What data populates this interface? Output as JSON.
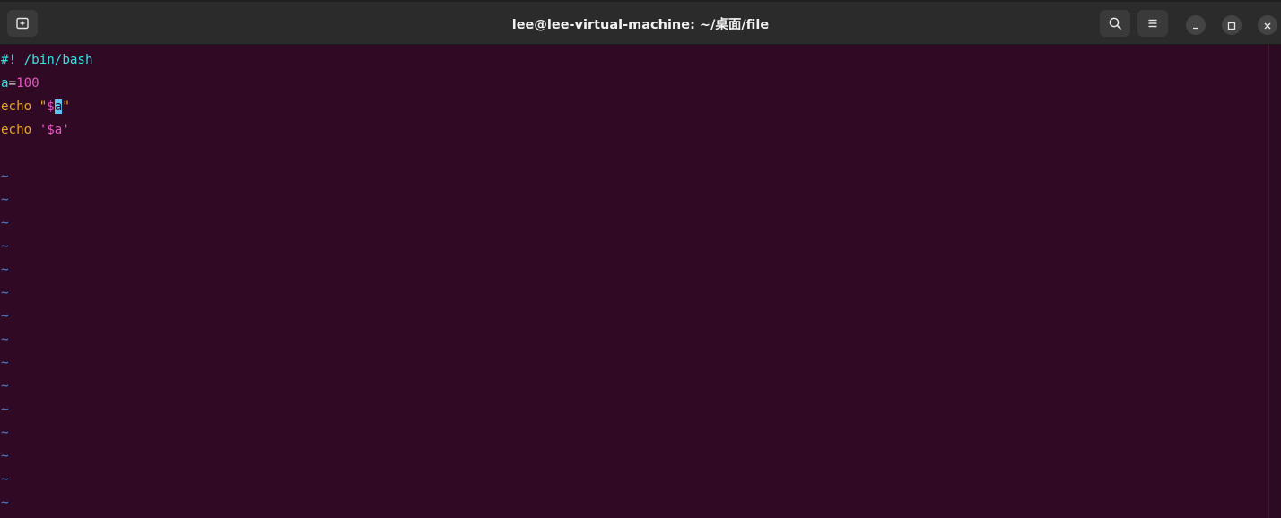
{
  "window": {
    "title": "lee@lee-virtual-machine: ~/桌面/file"
  },
  "header": {
    "new_tab_icon": "new-tab-icon",
    "search_icon": "search-icon",
    "menu_icon": "hamburger-menu-icon",
    "minimize_icon": "minimize-icon",
    "maximize_icon": "maximize-icon",
    "close_icon": "close-icon"
  },
  "editor": {
    "lines": [
      {
        "shebang": "#! /bin/bash"
      },
      {
        "var": "a",
        "op": "=",
        "num": "100"
      },
      {
        "kw": "echo",
        "sp": " ",
        "q_open": "\"",
        "dollar": "$",
        "cursor_char": "a",
        "q_close": "\""
      },
      {
        "kw": "echo",
        "sp": " ",
        "q_open": "'",
        "dollar": "$a",
        "q_close": "'"
      },
      {
        "blank": ""
      }
    ],
    "tilde": "~",
    "tilde_count": 15
  },
  "colors": {
    "background": "#300a24",
    "header": "#2b2b2b",
    "cyan": "#34e2e2",
    "magenta": "#e356c0",
    "keyword": "#e6a52a",
    "tilde": "#4f83c9",
    "cursor": "#5cc3f2"
  }
}
